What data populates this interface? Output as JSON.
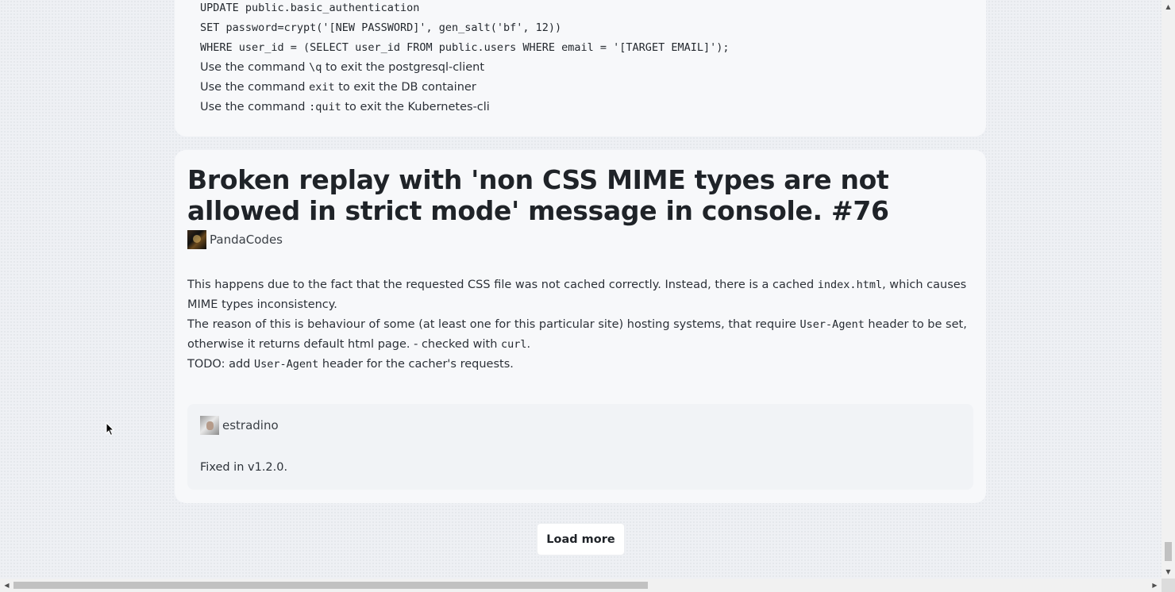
{
  "previous_issue": {
    "lines": [
      {
        "type": "mono",
        "text": "UPDATE public.basic_authentication"
      },
      {
        "type": "mono",
        "text": "SET password=crypt('[NEW PASSWORD]', gen_salt('bf', 12))"
      },
      {
        "type": "mono",
        "text": "WHERE user_id = (SELECT user_id FROM public.users WHERE email = '[TARGET EMAIL]');"
      }
    ],
    "exit_lines": [
      {
        "pre": "Use the command ",
        "code": "\\q",
        "post": " to exit the postgresql-client"
      },
      {
        "pre": "Use the command ",
        "code": "exit",
        "post": " to exit the DB container"
      },
      {
        "pre": "Use the command ",
        "code": ":quit",
        "post": " to exit the Kubernetes-cli"
      }
    ]
  },
  "issue": {
    "title": "Broken replay with 'non CSS MIME types are not allowed in strict mode' message in console. #76",
    "author": "PandaCodes",
    "author_avatar_icon": "avatar-image",
    "body": {
      "p1_pre": "This happens due to the fact that the requested CSS file was not cached correctly. Instead, there is a cached ",
      "p1_code": "index.html",
      "p1_post": ", which causes MIME types inconsistency.",
      "p2_pre": "The reason of this is behaviour of some (at least one for this particular site) hosting systems, that require ",
      "p2_code": "User-Agent",
      "p2_mid": " header to be set, otherwise it returns default html page. - checked with ",
      "p2_code2": "curl",
      "p2_post": ".",
      "p3_pre": "TODO: add ",
      "p3_code": "User-Agent",
      "p3_post": " header for the cacher's requests."
    },
    "comment": {
      "author": "estradino",
      "text": "Fixed in v1.2.0."
    }
  },
  "load_more_label": "Load more",
  "colors": {
    "page_bg": "#eef0f4",
    "card_bg": "#f7f8fa",
    "comment_bg": "#f1f3f6",
    "text": "#1f2328"
  }
}
